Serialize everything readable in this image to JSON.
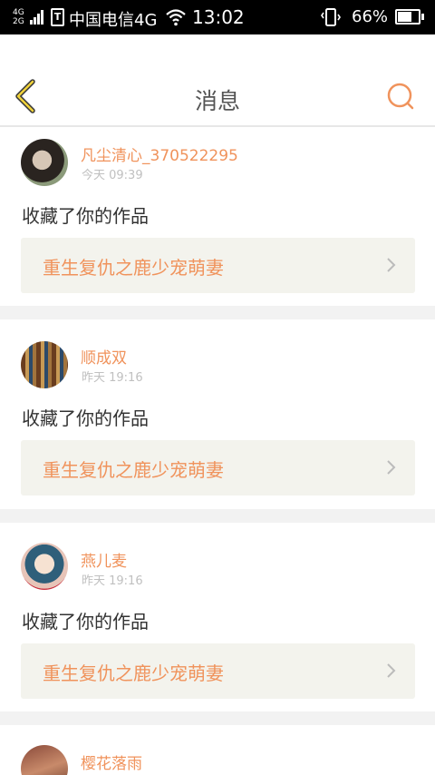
{
  "status_bar": {
    "signal_top": "4G",
    "signal_bottom": "2G",
    "sim": "T",
    "carrier": "中国电信4G",
    "time": "13:02",
    "battery_percent": "66%",
    "battery_level": 0.66
  },
  "header": {
    "title": "消息",
    "back_icon": "chevron-left-icon",
    "search_icon": "search-icon",
    "accent_color": "#f0935c"
  },
  "messages": [
    {
      "username": "凡尘清心_370522295",
      "time": "今天 09:39",
      "action": "收藏了你的作品",
      "work_title": "重生复仇之鹿少宠萌妻"
    },
    {
      "username": "顺成双",
      "time": "昨天 19:16",
      "action": "收藏了你的作品",
      "work_title": "重生复仇之鹿少宠萌妻"
    },
    {
      "username": "燕儿麦",
      "time": "昨天 19:16",
      "action": "收藏了你的作品",
      "work_title": "重生复仇之鹿少宠萌妻"
    },
    {
      "username": "樱花落雨"
    }
  ]
}
